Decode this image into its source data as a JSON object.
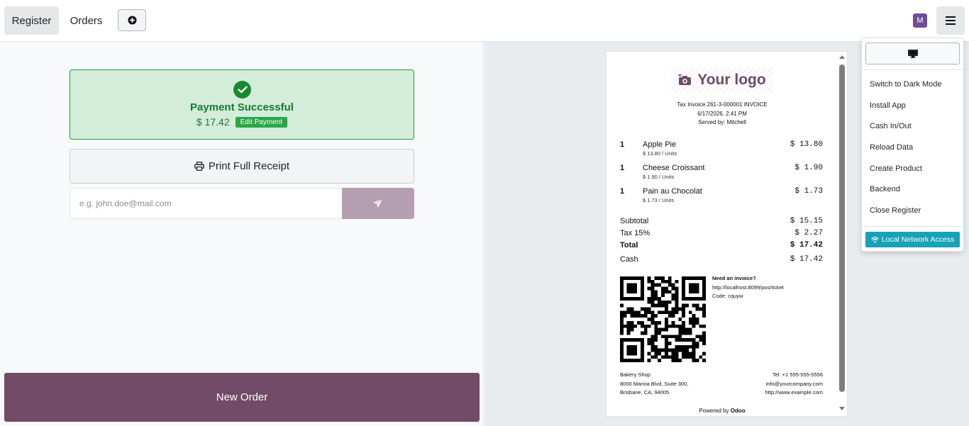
{
  "header": {
    "tabs": [
      {
        "label": "Register",
        "active": true
      },
      {
        "label": "Orders",
        "active": false
      }
    ],
    "add_icon": "plus-circle-icon",
    "avatar_letter": "M",
    "avatar_color": "#714b9a",
    "menu_icon": "hamburger-icon"
  },
  "payment": {
    "status_title": "Payment Successful",
    "amount": "$ 17.42",
    "edit_label": "Edit Payment",
    "success_color": "#157a2c"
  },
  "print_button": {
    "label": "Print Full Receipt",
    "icon": "printer-icon"
  },
  "email": {
    "placeholder": "e.g. john.doe@mail.com",
    "value": "",
    "send_icon": "paper-plane-icon"
  },
  "new_order_label": "New Order",
  "brand_color": "#714b67",
  "receipt": {
    "logo_text": "Your logo",
    "header_lines": [
      "Tax Invoice 261-3-000001 INVOICE",
      "6/17/2026, 2:41 PM",
      "Served by: Mitchell"
    ],
    "items": [
      {
        "qty": "1",
        "name": "Apple Pie",
        "unit": "$ 13.80 / Units",
        "price": "$ 13.80"
      },
      {
        "qty": "1",
        "name": "Cheese Croissant",
        "unit": "$ 1.90 / Units",
        "price": "$ 1.90"
      },
      {
        "qty": "1",
        "name": "Pain au Chocolat",
        "unit": "$ 1.73 / Units",
        "price": "$ 1.73"
      }
    ],
    "totals": [
      {
        "label": "Subtotal",
        "value": "$ 15.15",
        "bold": false
      },
      {
        "label": "Tax 15%",
        "value": "$ 2.27",
        "bold": false
      },
      {
        "label": "Total",
        "value": "$ 17.42",
        "bold": true
      }
    ],
    "payment_line": {
      "label": "Cash",
      "value": "$ 17.42"
    },
    "invoice_title": "Need an invoice?",
    "invoice_url": "http://localhost:8099/pos/ticket",
    "invoice_code": "Code: cquyw",
    "company_lines": [
      "Bakery Shop",
      "8000 Marina Blvd, Suite 300,",
      "Brisbane, CA, 94005"
    ],
    "contact_lines": [
      "Tel: +1 555-555-5556",
      "info@yourcompany.com",
      "http://www.example.com"
    ],
    "powered_prefix": "Powered by",
    "powered_brand": "Odoo"
  },
  "menu": {
    "display_icon": "monitor-icon",
    "items": [
      "Switch to Dark Mode",
      "Install App",
      "Cash In/Out",
      "Reload Data",
      "Create Product",
      "Backend",
      "Close Register"
    ],
    "network_button": {
      "label": "Local Network Access",
      "icon": "wifi-icon",
      "color": "#17a2b8"
    }
  }
}
